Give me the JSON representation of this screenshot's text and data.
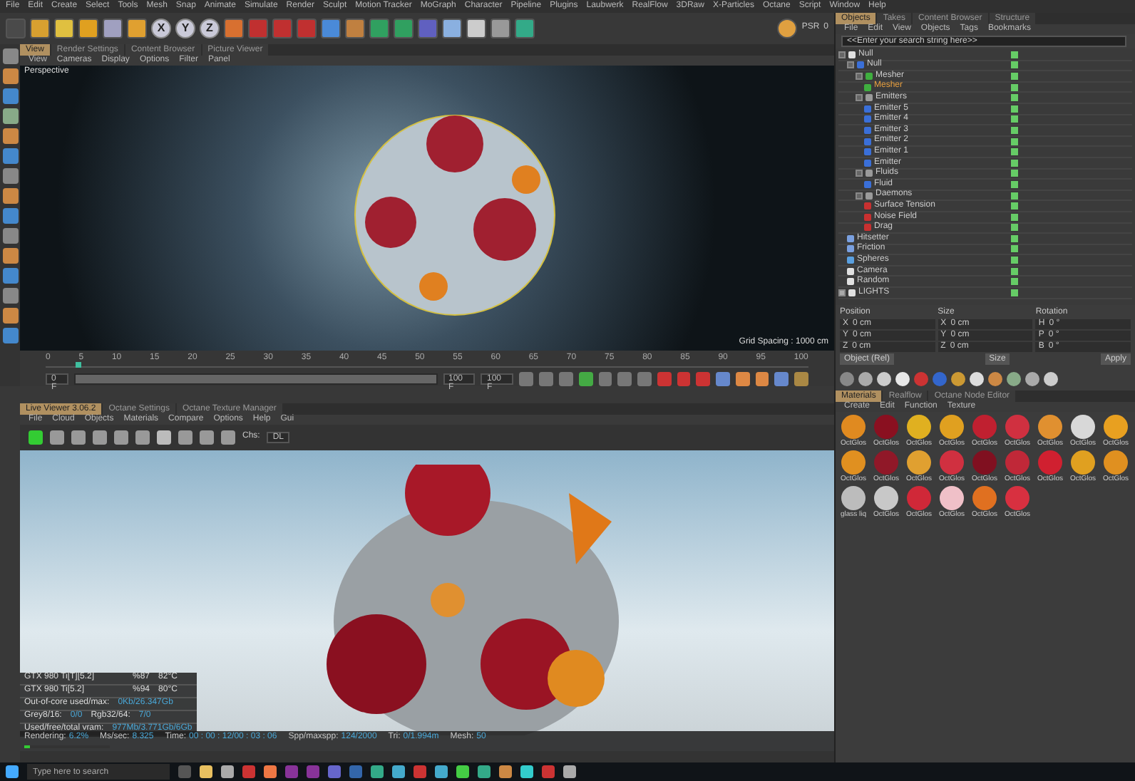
{
  "menu_bar": [
    "File",
    "Edit",
    "Create",
    "Select",
    "Tools",
    "Mesh",
    "Snap",
    "Animate",
    "Simulate",
    "Render",
    "Sculpt",
    "Motion Tracker",
    "MoGraph",
    "Character",
    "Pipeline",
    "Plugins",
    "Laubwerk",
    "RealFlow",
    "3DRaw",
    "X-Particles",
    "Octane",
    "Script",
    "Window",
    "Help"
  ],
  "toolbar": {
    "axes": [
      "X",
      "Y",
      "Z"
    ],
    "psr_label": "PSR",
    "psr_value": "0"
  },
  "viewport": {
    "tabs": [
      {
        "label": "View",
        "selected": true
      },
      {
        "label": "Render Settings",
        "selected": false
      },
      {
        "label": "Content Browser",
        "selected": false
      },
      {
        "label": "Picture Viewer",
        "selected": false
      }
    ],
    "menu": [
      "View",
      "Cameras",
      "Display",
      "Options",
      "Filter",
      "Panel"
    ],
    "camera": "Perspective",
    "grid": "Grid Spacing : 1000 cm"
  },
  "timeline": {
    "ticks": [
      "0",
      "5",
      "10",
      "15",
      "20",
      "25",
      "30",
      "35",
      "40",
      "45",
      "50",
      "55",
      "60",
      "65",
      "70",
      "75",
      "80",
      "85",
      "90",
      "95",
      "100"
    ],
    "level": 0.04,
    "range": {
      "level": 1
    },
    "start": "0 F",
    "range_end": "100 F",
    "current": "100 F"
  },
  "object_manager": {
    "tabs": [
      {
        "label": "Objects",
        "selected": true
      },
      {
        "label": "Takes",
        "selected": false
      },
      {
        "label": "Content Browser",
        "selected": false
      },
      {
        "label": "Structure",
        "selected": false
      }
    ],
    "menu": [
      "File",
      "Edit",
      "View",
      "Objects",
      "Tags",
      "Bookmarks"
    ],
    "placeholder": "<<Enter your search string here>>",
    "tree": [
      {
        "label": "Null",
        "color": "#e0e0e0",
        "expanded": true,
        "children": [
          {
            "label": "Null",
            "color": "#3a6fd8",
            "expanded": true,
            "children": [
              {
                "label": "Mesher",
                "color": "#3fae3f",
                "expanded": true,
                "children": [
                  {
                    "label": "Mesher",
                    "color": "#3fae3f",
                    "selected": true
                  }
                ]
              },
              {
                "label": "Emitters",
                "color": "#9a9a9a",
                "expanded": true,
                "children": [
                  {
                    "label": "Emitter 5",
                    "color": "#3a6fd8"
                  },
                  {
                    "label": "Emitter 4",
                    "color": "#3a6fd8"
                  },
                  {
                    "label": "Emitter 3",
                    "color": "#3a6fd8"
                  },
                  {
                    "label": "Emitter 2",
                    "color": "#3a6fd8"
                  },
                  {
                    "label": "Emitter 1",
                    "color": "#3a6fd8"
                  },
                  {
                    "label": "Emitter",
                    "color": "#3a6fd8"
                  }
                ]
              },
              {
                "label": "Fluids",
                "color": "#9a9a9a",
                "expanded": true,
                "children": [
                  {
                    "label": "Fluid",
                    "color": "#3a6fd8"
                  }
                ]
              },
              {
                "label": "Daemons",
                "color": "#9a9a9a",
                "expanded": true,
                "children": [
                  {
                    "label": "Surface Tension",
                    "color": "#c83030"
                  },
                  {
                    "label": "Noise Field",
                    "color": "#c83030"
                  },
                  {
                    "label": "Drag",
                    "color": "#c83030"
                  }
                ]
              }
            ]
          },
          {
            "label": "Hitsetter",
            "color": "#7aa0e0"
          },
          {
            "label": "Friction",
            "color": "#7aa0e0"
          },
          {
            "label": "Spheres",
            "color": "#5aa0e0"
          },
          {
            "label": "Camera",
            "color": "#e0e0e0"
          },
          {
            "label": "Random",
            "color": "#e0e0e0"
          }
        ]
      },
      {
        "label": "LIGHTS",
        "color": "#e0e0e0",
        "expanded": false
      }
    ]
  },
  "attributes": {
    "groups": [
      {
        "title": "Position",
        "fields": [
          {
            "axis": "X",
            "value": "0 cm"
          },
          {
            "axis": "Y",
            "value": "0 cm"
          },
          {
            "axis": "Z",
            "value": "0 cm"
          }
        ]
      },
      {
        "title": "Size",
        "fields": [
          {
            "axis": "X",
            "value": "0 cm"
          },
          {
            "axis": "Y",
            "value": "0 cm"
          },
          {
            "axis": "Z",
            "value": "0 cm"
          }
        ]
      },
      {
        "title": "Rotation",
        "fields": [
          {
            "axis": "H",
            "value": "0 °"
          },
          {
            "axis": "P",
            "value": "0 °"
          },
          {
            "axis": "B",
            "value": "0 °"
          }
        ]
      }
    ],
    "mode": "Object (Rel)",
    "size_mode": "Size",
    "apply": "Apply"
  },
  "material_manager": {
    "tabs": [
      {
        "label": "Materials",
        "selected": true
      },
      {
        "label": "Realflow",
        "selected": false
      },
      {
        "label": "Octane Node Editor",
        "selected": false
      }
    ],
    "menu": [
      "Create",
      "Edit",
      "Function",
      "Texture"
    ],
    "materials": [
      {
        "name": "OctGlos",
        "color": "#e08a20"
      },
      {
        "name": "OctGlos",
        "color": "#8a1020"
      },
      {
        "name": "OctGlos",
        "color": "#e0b020"
      },
      {
        "name": "OctGlos",
        "color": "#e0a020"
      },
      {
        "name": "OctGlos",
        "color": "#c02030"
      },
      {
        "name": "OctGlos",
        "color": "#d03040"
      },
      {
        "name": "OctGlos",
        "color": "#e09030"
      },
      {
        "name": "OctGlos",
        "color": "#d8d8d8"
      },
      {
        "name": "OctGlos",
        "color": "#e8a020"
      },
      {
        "name": "OctGlos",
        "color": "#e09020"
      },
      {
        "name": "OctGlos",
        "color": "#901828"
      },
      {
        "name": "OctGlos",
        "color": "#e0a030"
      },
      {
        "name": "OctGlos",
        "color": "#d03040"
      },
      {
        "name": "OctGlos",
        "color": "#801020"
      },
      {
        "name": "OctGlos",
        "color": "#c02838"
      },
      {
        "name": "OctGlos",
        "color": "#d02030"
      },
      {
        "name": "OctGlos",
        "color": "#e0a020"
      },
      {
        "name": "OctGlos",
        "color": "#e09020"
      },
      {
        "name": "glass liq",
        "color": "#bcbcbc"
      },
      {
        "name": "OctGlos",
        "color": "#c8c8c8"
      },
      {
        "name": "OctGlos",
        "color": "#d02838"
      },
      {
        "name": "OctGlos",
        "color": "#f0c0c8"
      },
      {
        "name": "OctGlos",
        "color": "#e07020"
      },
      {
        "name": "OctGlos",
        "color": "#d83040"
      }
    ]
  },
  "live_viewer": {
    "tabs": [
      {
        "label": "Live Viewer 3.06.2",
        "selected": true
      },
      {
        "label": "Octane Settings",
        "selected": false
      },
      {
        "label": "Octane Texture Manager",
        "selected": false
      }
    ],
    "menu": [
      "File",
      "Cloud",
      "Objects",
      "Materials",
      "Compare",
      "Options",
      "Help",
      "Gui"
    ],
    "channel_label": "Chs:",
    "channel_value": "DL",
    "gpus": [
      {
        "name": "GTX 980 Ti[T][5.2]",
        "load": "%87",
        "temp": "82°C"
      },
      {
        "name": "GTX 980 Ti[5.2]",
        "load": "%94",
        "temp": "80°C"
      }
    ],
    "memory": [
      {
        "label": "Out-of-core used/max:",
        "value": "0Kb/26.347Gb"
      },
      {
        "label": "Grey8/16:",
        "value": "0/0",
        "label2": "Rgb32/64:",
        "value2": "7/0"
      },
      {
        "label": "Used/free/total vram:",
        "value": "977Mb/3.771Gb/6Gb"
      }
    ],
    "status": [
      {
        "label": "Rendering:",
        "value": "6.2%"
      },
      {
        "label": "Ms/sec:",
        "value": "8.325"
      },
      {
        "label": "Time:",
        "value": "00 : 00 : 12/00 : 03 : 06"
      },
      {
        "label": "Spp/maxspp:",
        "value": "124/2000"
      },
      {
        "label": "Tri:",
        "value": "0/1.994m"
      },
      {
        "label": "Mesh:",
        "value": "50"
      }
    ],
    "level": 0.062
  },
  "taskbar": {
    "placeholder": "Type here to search"
  }
}
